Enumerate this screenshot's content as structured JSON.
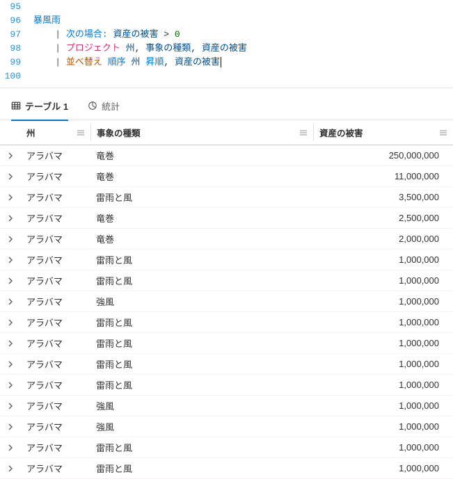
{
  "editor": {
    "lines": [
      {
        "num": "95",
        "tokens": []
      },
      {
        "num": "96",
        "tokens": [
          {
            "cls": "tok-table",
            "t": "暴風雨"
          }
        ]
      },
      {
        "num": "97",
        "tokens": [
          {
            "cls": "tok-pipe",
            "t": "| "
          },
          {
            "cls": "tok-op",
            "t": "次の場合:"
          },
          {
            "cls": "",
            "t": " "
          },
          {
            "cls": "tok-col",
            "t": "資産の被害"
          },
          {
            "cls": "",
            "t": " > "
          },
          {
            "cls": "tok-num",
            "t": "0"
          }
        ]
      },
      {
        "num": "98",
        "tokens": [
          {
            "cls": "tok-pipe",
            "t": "| "
          },
          {
            "cls": "tok-kw",
            "t": "プロジェクト"
          },
          {
            "cls": "",
            "t": " "
          },
          {
            "cls": "tok-col",
            "t": "州"
          },
          {
            "cls": "",
            "t": ", "
          },
          {
            "cls": "tok-col",
            "t": "事象の種類"
          },
          {
            "cls": "",
            "t": ", "
          },
          {
            "cls": "tok-col",
            "t": "資産の被害"
          }
        ]
      },
      {
        "num": "99",
        "tokens": [
          {
            "cls": "tok-pipe",
            "t": "| "
          },
          {
            "cls": "tok-ord",
            "t": "並べ替え"
          },
          {
            "cls": "",
            "t": " "
          },
          {
            "cls": "tok-asc",
            "t": "順序"
          },
          {
            "cls": "",
            "t": " "
          },
          {
            "cls": "tok-col",
            "t": "州"
          },
          {
            "cls": "",
            "t": " "
          },
          {
            "cls": "tok-asc",
            "t": "昇順"
          },
          {
            "cls": "",
            "t": ", "
          },
          {
            "cls": "tok-col",
            "t": "資産の被害"
          }
        ],
        "cursor": true
      },
      {
        "num": "100",
        "tokens": []
      }
    ]
  },
  "tabs": {
    "table": "テーブル 1",
    "stats": "統計"
  },
  "table": {
    "headers": {
      "state": "州",
      "event": "事象の種類",
      "damage": "資産の被害"
    },
    "rows": [
      {
        "state": "アラバマ",
        "event": "竜巻",
        "damage": "250,000,000"
      },
      {
        "state": "アラバマ",
        "event": "竜巻",
        "damage": "11,000,000"
      },
      {
        "state": "アラバマ",
        "event": "雷雨と風",
        "damage": "3,500,000"
      },
      {
        "state": "アラバマ",
        "event": "竜巻",
        "damage": "2,500,000"
      },
      {
        "state": "アラバマ",
        "event": "竜巻",
        "damage": "2,000,000"
      },
      {
        "state": "アラバマ",
        "event": "雷雨と風",
        "damage": "1,000,000"
      },
      {
        "state": "アラバマ",
        "event": "雷雨と風",
        "damage": "1,000,000"
      },
      {
        "state": "アラバマ",
        "event": "強風",
        "damage": "1,000,000"
      },
      {
        "state": "アラバマ",
        "event": "雷雨と風",
        "damage": "1,000,000"
      },
      {
        "state": "アラバマ",
        "event": "雷雨と風",
        "damage": "1,000,000"
      },
      {
        "state": "アラバマ",
        "event": "雷雨と風",
        "damage": "1,000,000"
      },
      {
        "state": "アラバマ",
        "event": "雷雨と風",
        "damage": "1,000,000"
      },
      {
        "state": "アラバマ",
        "event": "強風",
        "damage": "1,000,000"
      },
      {
        "state": "アラバマ",
        "event": "強風",
        "damage": "1,000,000"
      },
      {
        "state": "アラバマ",
        "event": "雷雨と風",
        "damage": "1,000,000"
      },
      {
        "state": "アラバマ",
        "event": "雷雨と風",
        "damage": "1,000,000"
      }
    ]
  }
}
